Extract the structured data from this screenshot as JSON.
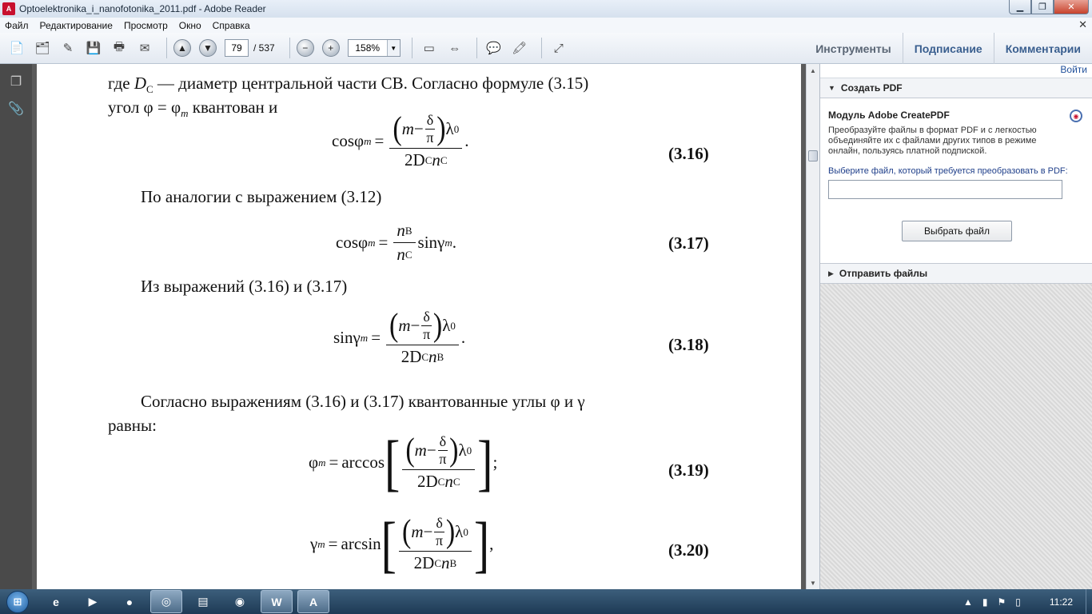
{
  "window": {
    "title": "Optoelektronika_i_nanofotonika_2011.pdf - Adobe Reader",
    "app_icon": "adobe-reader-icon"
  },
  "menu": {
    "items": [
      "Файл",
      "Редактирование",
      "Просмотр",
      "Окно",
      "Справка"
    ]
  },
  "toolbar": {
    "page_current": "79",
    "page_total": "/ 537",
    "zoom": "158%",
    "tools_label": "Инструменты",
    "sign_label": "Подписание",
    "comments_label": "Комментарии"
  },
  "document": {
    "p1_line1_a": "где ",
    "p1_line1_D": "D",
    "p1_line1_sub": "C",
    "p1_line1_b": " — диаметр центральной части СВ. Согласно формуле (3.15)",
    "p1_line2_a": "угол φ = φ",
    "p1_line2_sub": "m",
    "p1_line2_b": " квантован и",
    "eq16_num": "(3.16)",
    "p2": "По аналогии с выражением (3.12)",
    "eq17_num": "(3.17)",
    "p3": "Из выражений (3.16) и (3.17)",
    "eq18_num": "(3.18)",
    "p4_line1": "Согласно выражениям (3.16) и (3.17) квантованные углы φ и γ",
    "p4_line2": "равны:",
    "eq19_num": "(3.19)",
    "eq20_num": "(3.20)",
    "sym_cos": "cos",
    "sym_sin": "sin",
    "sym_arccos": "arccos",
    "sym_arcsin": "arcsin",
    "sym_phi": "φ",
    "sym_gamma": "γ",
    "sym_m": "m",
    "sym_minus": "−",
    "sym_delta": "δ",
    "sym_pi": "π",
    "sym_lambda": "λ",
    "sub_0": "0",
    "sym_2D": "2D",
    "sub_C": "C",
    "sub_B": "B",
    "sym_n": "n",
    "eq_equals": "=",
    "punct_period": ".",
    "punct_semicolon": ";",
    "punct_comma": ","
  },
  "right_pane": {
    "sign_in": "Войти",
    "create_pdf": "Создать PDF",
    "module_title": "Модуль Adobe CreatePDF",
    "module_desc": "Преобразуйте файлы в формат PDF и с легкостью объединяйте их с файлами других типов в режиме онлайн, пользуясь платной подпиской.",
    "select_prompt": "Выберите файл, который требуется преобразовать в PDF:",
    "choose_button": "Выбрать файл",
    "send_files": "Отправить файлы"
  },
  "taskbar": {
    "clock": "11:22"
  }
}
